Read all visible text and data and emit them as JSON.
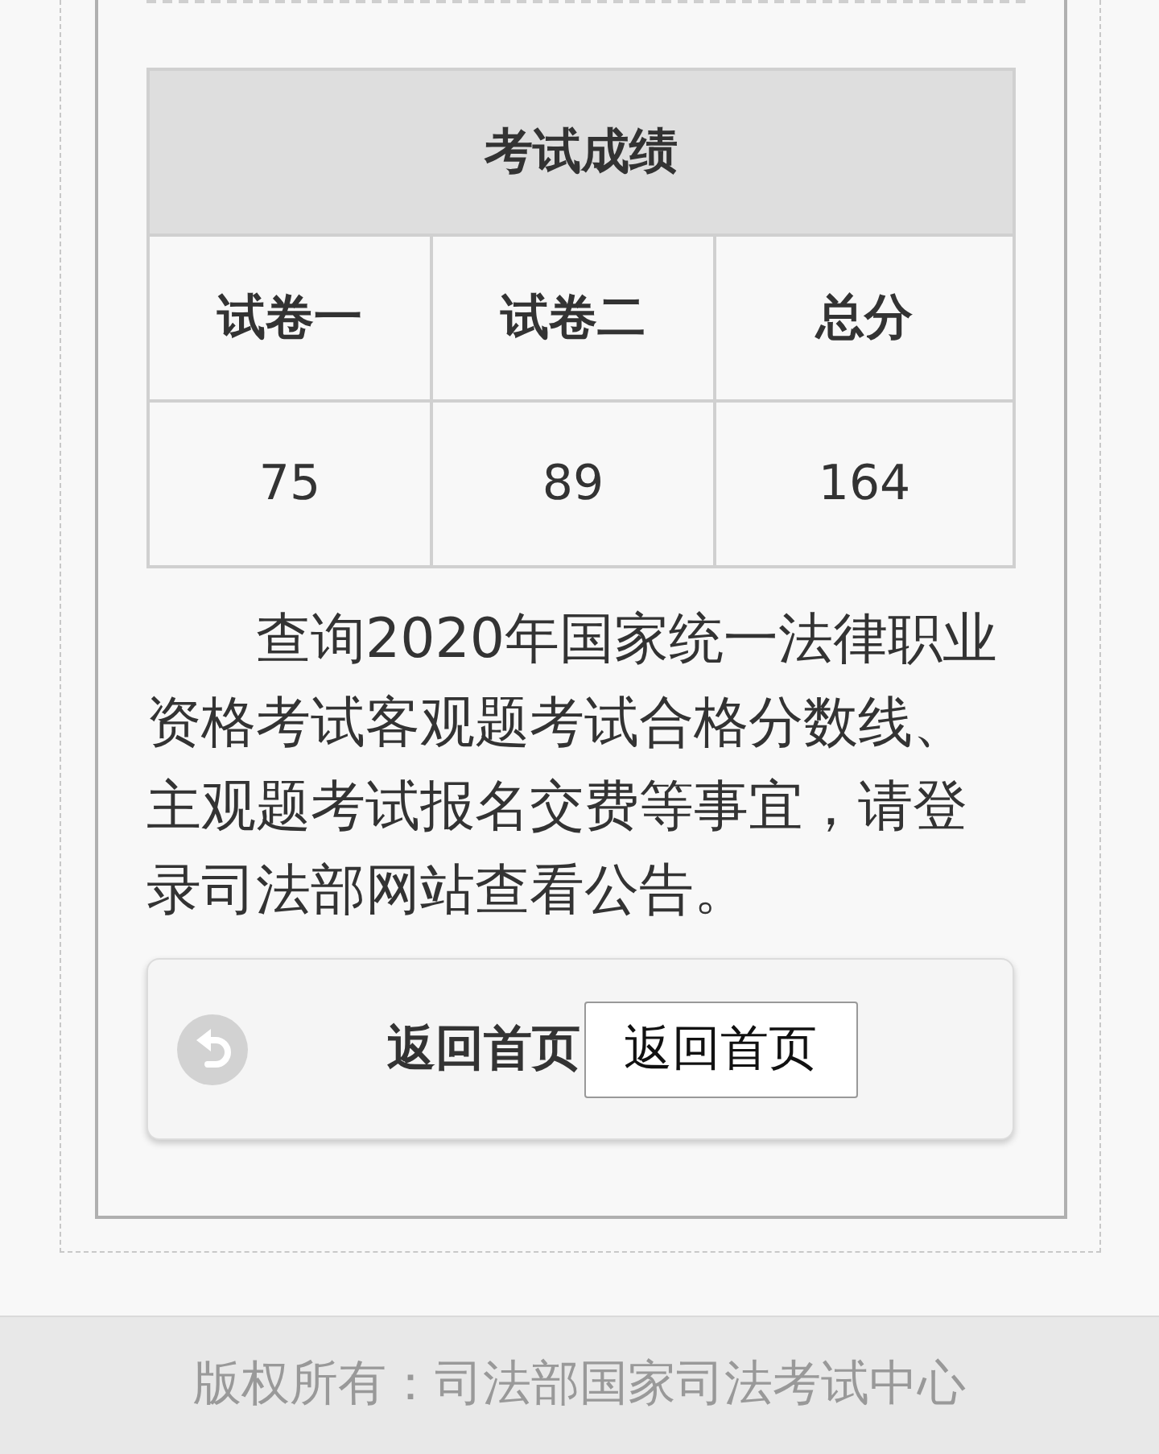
{
  "table": {
    "title": "考试成绩",
    "columns": [
      "试卷一",
      "试卷二",
      "总分"
    ],
    "rows": [
      [
        "75",
        "89",
        "164"
      ]
    ]
  },
  "notice": "查询2020年国家统一法律职业资格考试客观题考试合格分数线、主观题考试报名交费等事宜，请登录司法部网站查看公告。",
  "back_panel": {
    "label": "返回首页",
    "button": "返回首页"
  },
  "footer": {
    "copyright": "版权所有：司法部国家司法考试中心"
  }
}
